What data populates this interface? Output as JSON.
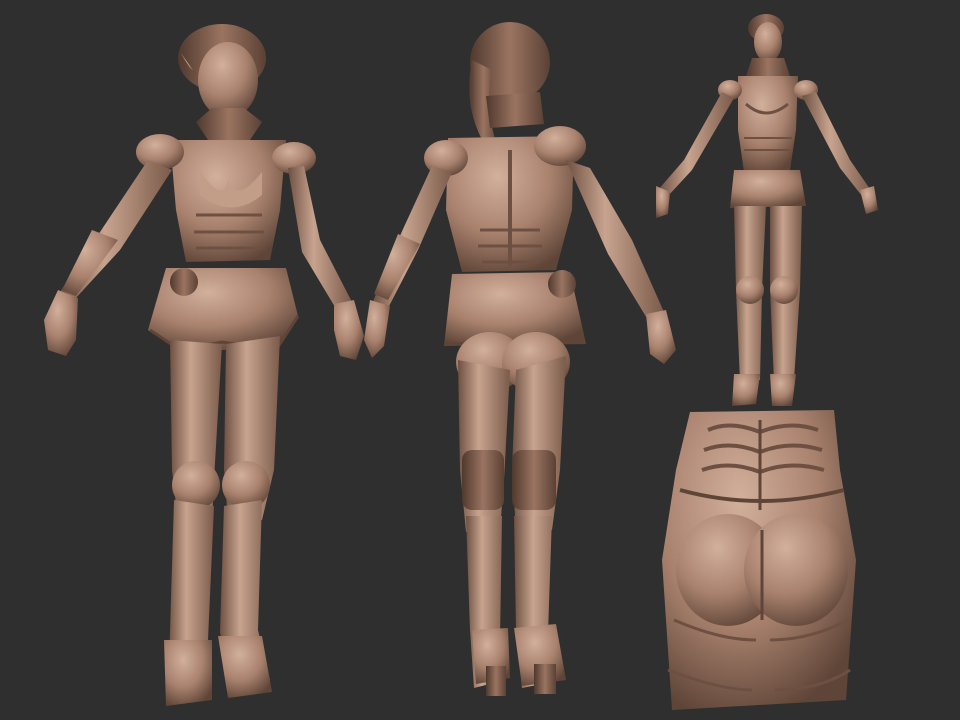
{
  "scene": {
    "background_color": "#2f2f2f",
    "material_color": "#a9826e",
    "material_highlight": "#d2b09c",
    "material_shadow": "#5f4538"
  },
  "views": [
    {
      "name": "front-view"
    },
    {
      "name": "back-view"
    },
    {
      "name": "small-front-view"
    },
    {
      "name": "hip-detail-view"
    }
  ]
}
